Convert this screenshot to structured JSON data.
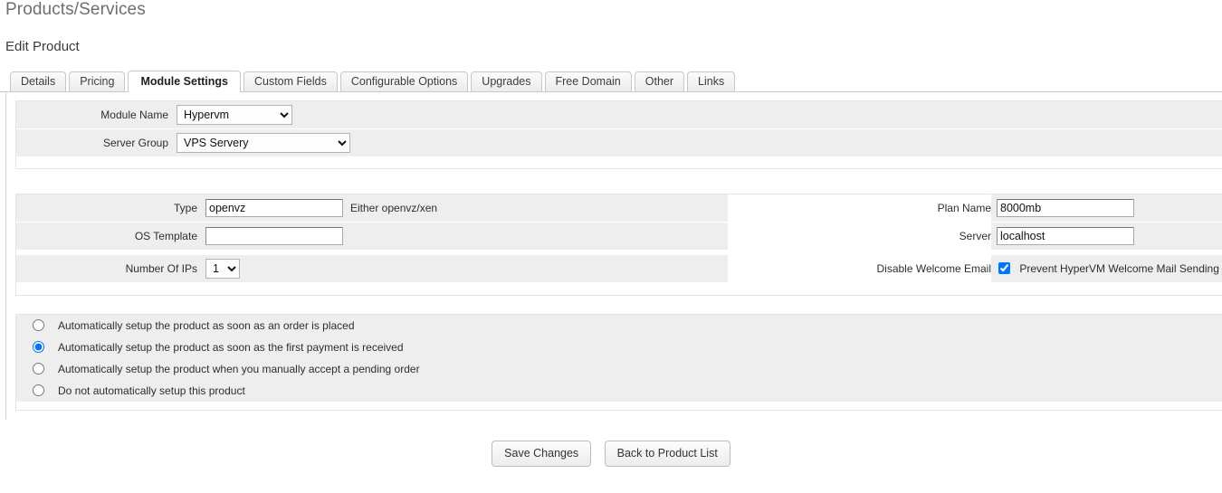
{
  "header": {
    "page_heading": "Products/Services",
    "sub_heading": "Edit Product"
  },
  "tabs": [
    {
      "label": "Details",
      "active": false
    },
    {
      "label": "Pricing",
      "active": false
    },
    {
      "label": "Module Settings",
      "active": true
    },
    {
      "label": "Custom Fields",
      "active": false
    },
    {
      "label": "Configurable Options",
      "active": false
    },
    {
      "label": "Upgrades",
      "active": false
    },
    {
      "label": "Free Domain",
      "active": false
    },
    {
      "label": "Other",
      "active": false
    },
    {
      "label": "Links",
      "active": false
    }
  ],
  "module_panel": {
    "module_name": {
      "label": "Module Name",
      "value": "Hypervm",
      "options": [
        "Hypervm"
      ]
    },
    "server_group": {
      "label": "Server Group",
      "value": "VPS Servery",
      "options": [
        "VPS Servery"
      ]
    }
  },
  "fields_panel": {
    "left": [
      {
        "label": "Type",
        "value": "openvz",
        "help": "Either openvz/xen",
        "control": "text"
      },
      {
        "label": "OS Template",
        "value": "",
        "help": "",
        "control": "text"
      },
      {
        "label": "Number Of IPs",
        "value": "1",
        "help": "",
        "control": "select",
        "options": [
          "1"
        ]
      }
    ],
    "right": [
      {
        "label": "Plan Name",
        "value": "8000mb",
        "control": "text"
      },
      {
        "label": "Server",
        "value": "localhost",
        "control": "text"
      },
      {
        "label": "Disable Welcome Email",
        "control": "checkbox",
        "checked": true,
        "checkbox_label": "Prevent HyperVM Welcome Mail Sending"
      }
    ]
  },
  "autosetup": {
    "options": [
      {
        "label": "Automatically setup the product as soon as an order is placed",
        "selected": false
      },
      {
        "label": "Automatically setup the product as soon as the first payment is received",
        "selected": true
      },
      {
        "label": "Automatically setup the product when you manually accept a pending order",
        "selected": false
      },
      {
        "label": "Do not automatically setup this product",
        "selected": false
      }
    ]
  },
  "buttons": {
    "save": "Save Changes",
    "back": "Back to Product List"
  },
  "colors": {
    "row_bg": "#eeeeee",
    "panel_border": "#dfe6e9",
    "heading": "#6e6e6e",
    "text": "#2e2e2e"
  }
}
